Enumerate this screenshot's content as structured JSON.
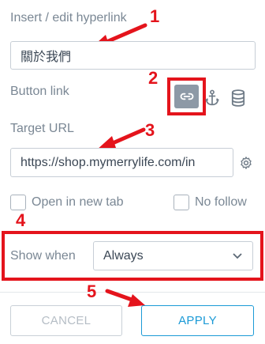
{
  "header": {
    "title": "Insert / edit hyperlink"
  },
  "text_field": {
    "value": "關於我們"
  },
  "button_link": {
    "label": "Button link",
    "icons": [
      "link-icon",
      "anchor-icon",
      "database-icon"
    ],
    "selected": "link-icon"
  },
  "target_url": {
    "label": "Target URL",
    "value": "https://shop.mymerrylife.com/in",
    "icon": "gear-icon"
  },
  "options": {
    "open_new_tab": {
      "label": "Open in new tab",
      "checked": false
    },
    "no_follow": {
      "label": "No follow",
      "checked": false
    }
  },
  "show_when": {
    "label": "Show when",
    "value": "Always",
    "icon": "chevron-down-icon"
  },
  "buttons": {
    "cancel": "CANCEL",
    "apply": "APPLY"
  },
  "annotations": {
    "n1": "1",
    "n2": "2",
    "n3": "3",
    "n4": "4",
    "n5": "5"
  },
  "colors": {
    "annotation": "#e4141c",
    "accent": "#1b9ad6",
    "selected_icon_bg": "#8d99a6"
  }
}
